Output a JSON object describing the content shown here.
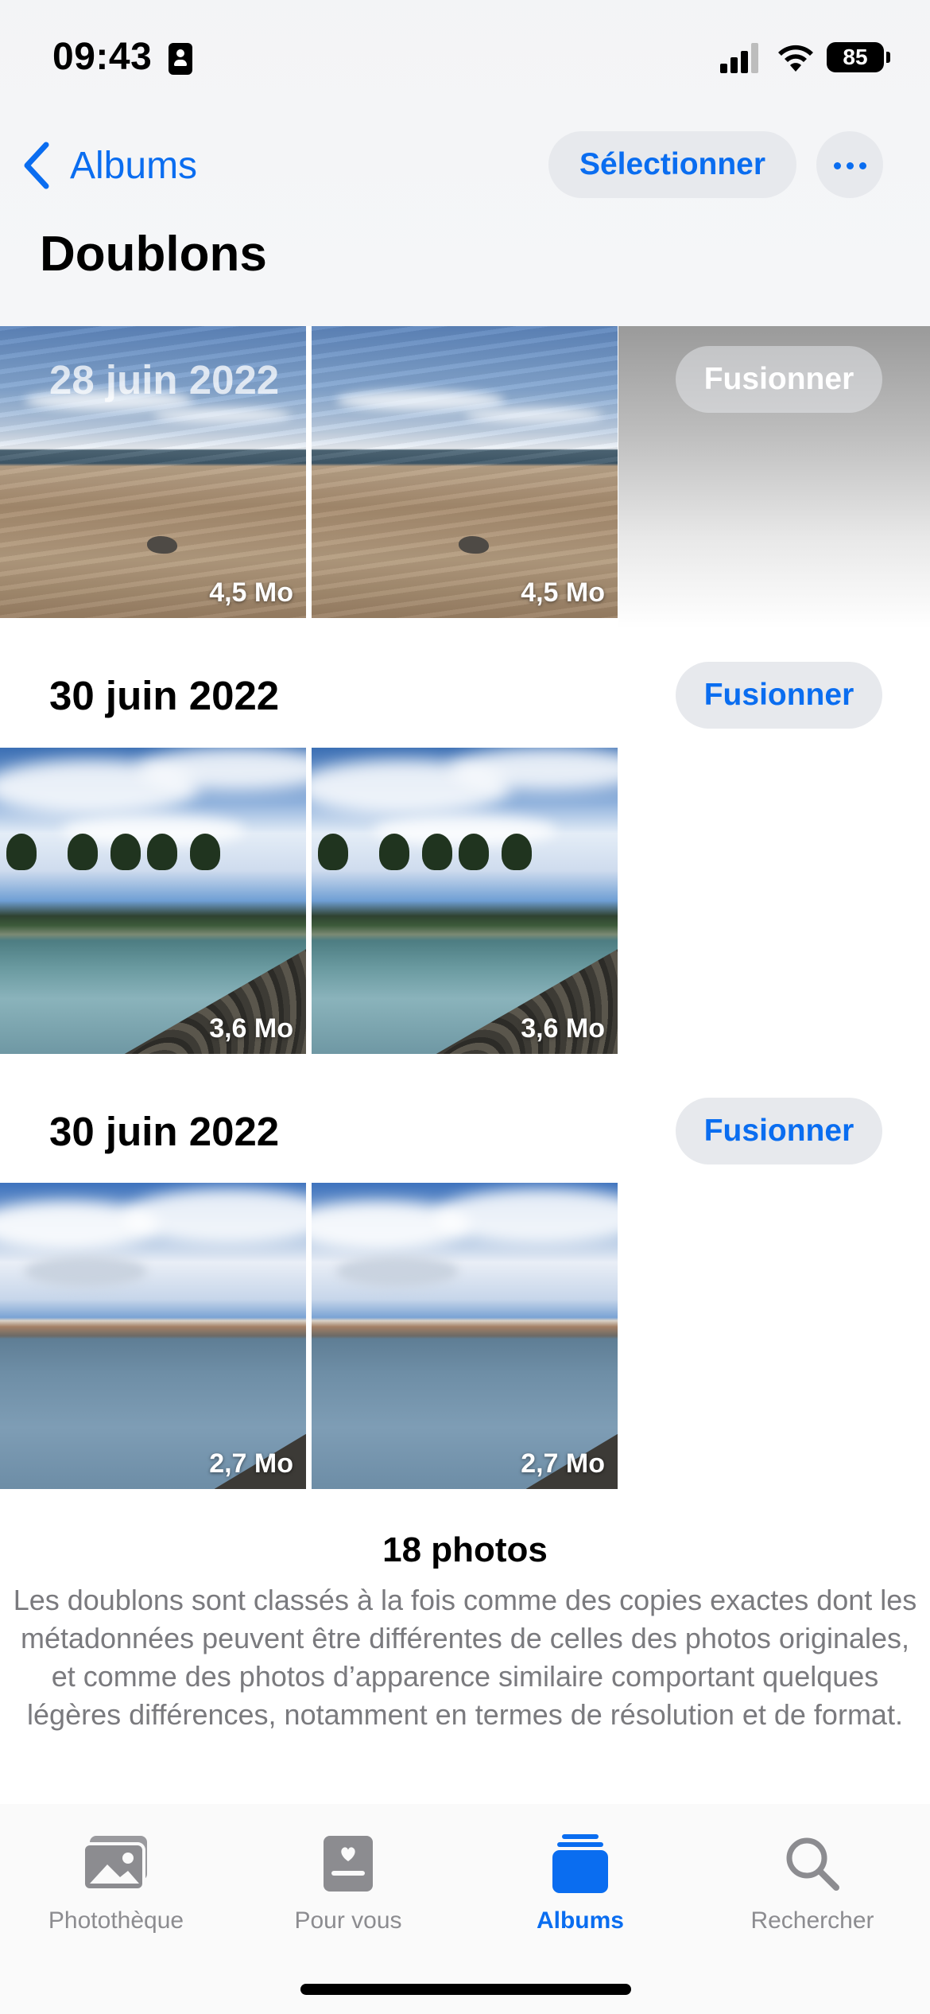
{
  "status_bar": {
    "time": "09:43",
    "battery": "85"
  },
  "nav": {
    "back_label": "Albums",
    "select_label": "Sélectionner",
    "title": "Doublons"
  },
  "groups": [
    {
      "date": "28 juin 2022",
      "merge_label": "Fusionner",
      "photos": [
        {
          "size": "4,5 Mo"
        },
        {
          "size": "4,5 Mo"
        }
      ]
    },
    {
      "date": "30 juin 2022",
      "merge_label": "Fusionner",
      "photos": [
        {
          "size": "3,6 Mo"
        },
        {
          "size": "3,6 Mo"
        }
      ]
    },
    {
      "date": "30 juin 2022",
      "merge_label": "Fusionner",
      "photos": [
        {
          "size": "2,7 Mo"
        },
        {
          "size": "2,7 Mo"
        }
      ]
    }
  ],
  "footer": {
    "count": "18 photos",
    "description": "Les doublons sont classés à la fois comme des copies exactes dont les métadonnées peuvent être différentes de celles des photos originales, et comme des photos d’apparence similaire comportant quelques légères différences, notamment en termes de résolution et de format."
  },
  "tabs": [
    {
      "label": "Photothèque",
      "icon": "photo-library-icon"
    },
    {
      "label": "Pour vous",
      "icon": "for-you-icon"
    },
    {
      "label": "Albums",
      "icon": "albums-icon",
      "active": true
    },
    {
      "label": "Rechercher",
      "icon": "search-icon"
    }
  ],
  "colors": {
    "accent": "#0a6df0",
    "inactive": "#8c8c90",
    "pill_bg": "#e7e9ed"
  }
}
